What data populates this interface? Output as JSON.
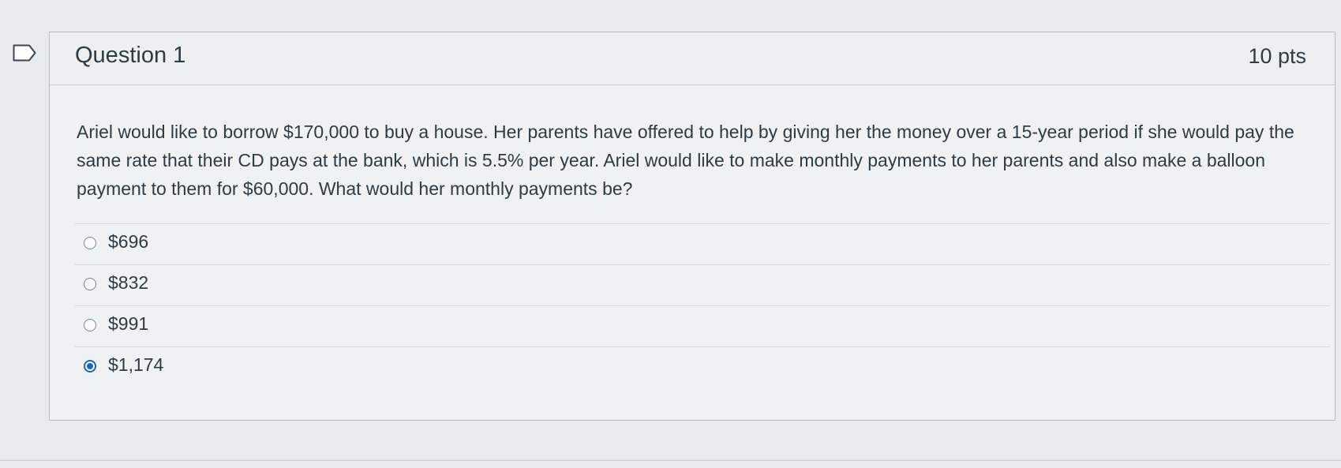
{
  "question": {
    "title": "Question 1",
    "points": "10 pts",
    "text": "Ariel would like to borrow $170,000 to buy a house. Her parents have offered to help by giving her the money over a 15-year period if she would pay the same rate that their CD pays at the bank, which is 5.5% per year. Ariel would like to make monthly payments to her parents and also make a balloon payment to them for $60,000. What would her monthly payments be?"
  },
  "answers": [
    {
      "label": "$696",
      "selected": false
    },
    {
      "label": "$832",
      "selected": false
    },
    {
      "label": "$991",
      "selected": false
    },
    {
      "label": "$1,174",
      "selected": true
    }
  ],
  "icons": {
    "flag": "bookmark-flag-icon"
  },
  "colors": {
    "selected_radio": "#1a66b9",
    "text": "#2d3b45",
    "background": "#e9eaec"
  }
}
